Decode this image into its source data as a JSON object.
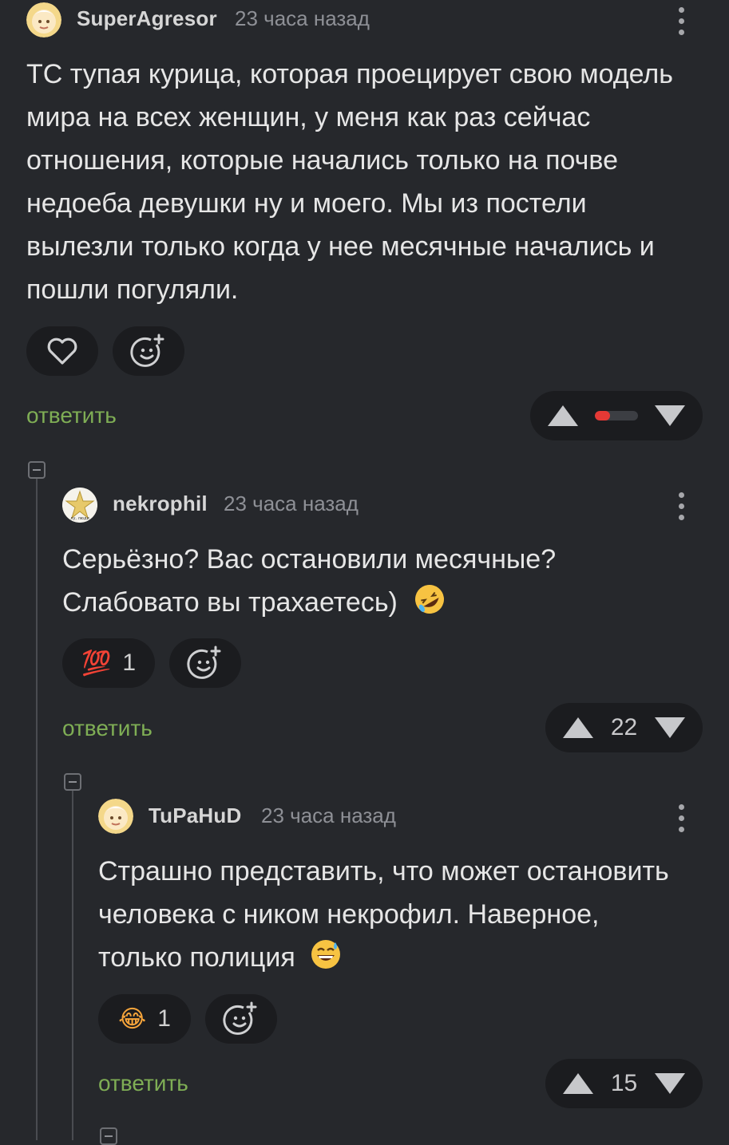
{
  "comments": [
    {
      "username": "SuperAgresor",
      "time": "23 часа назад",
      "text": "ТС тупая курица, которая проецирует свою модель мира на всех женщин, у меня как раз сейчас отношения, которые начались только на почве недоеба девушки ну и моего. Мы из постели вылезли только когда у нее месячные начались и пошли погуляли.",
      "reply_label": "ответить",
      "rating_bar": {
        "negative_fraction": 0.35,
        "negative_color": "#e53935",
        "neutral_color": "#3c3e43"
      }
    },
    {
      "username": "nekrophil",
      "time": "23 часа назад",
      "text": "Серьёзно? Вас остановили месячные? Слабовато вы трахаетесь)",
      "reaction": {
        "emoji": "💯",
        "count": "1"
      },
      "reply_label": "ответить",
      "score": "22"
    },
    {
      "username": "TuPaHuD",
      "time": "23 часа назад",
      "text": "Страшно представить, что может остановить человека с ником некрофил. Наверное, только полиция",
      "reaction": {
        "emoji": "😂",
        "count": "1"
      },
      "reply_label": "ответить",
      "score": "15"
    }
  ],
  "icons": {
    "like": "heart-icon",
    "add_reaction": "smiley-plus-icon",
    "upvote": "triangle-up-icon",
    "downvote": "triangle-down-icon",
    "menu": "kebab-menu-icon",
    "collapse": "collapse-minus-icon"
  },
  "colors": {
    "background": "#26282c",
    "reply": "#7fae55",
    "pill": "#1b1c1f"
  }
}
